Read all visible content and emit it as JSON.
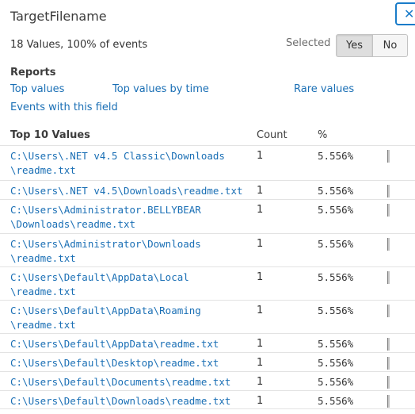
{
  "header": {
    "title": "TargetFilename",
    "close_label": "✕"
  },
  "summary": {
    "text": "18 Values, 100% of events",
    "selected_label": "Selected",
    "yes_label": "Yes",
    "no_label": "No"
  },
  "reports": {
    "heading": "Reports",
    "links": {
      "top_values": "Top values",
      "top_values_by_time": "Top values by time",
      "rare_values": "Rare values",
      "events_with_field": "Events with this field"
    }
  },
  "table": {
    "heading": "Top 10 Values",
    "count_header": "Count",
    "pct_header": "%",
    "rows": [
      {
        "path": "C:\\Users\\.NET v4.5 Classic\\Downloads\n\\readme.txt",
        "count": "1",
        "pct": "5.556%",
        "bar_fraction": 0.05556
      },
      {
        "path": "C:\\Users\\.NET v4.5\\Downloads\\readme.txt",
        "count": "1",
        "pct": "5.556%",
        "bar_fraction": 0.05556
      },
      {
        "path": "C:\\Users\\Administrator.BELLYBEAR\n\\Downloads\\readme.txt",
        "count": "1",
        "pct": "5.556%",
        "bar_fraction": 0.05556
      },
      {
        "path": "C:\\Users\\Administrator\\Downloads\n\\readme.txt",
        "count": "1",
        "pct": "5.556%",
        "bar_fraction": 0.05556
      },
      {
        "path": "C:\\Users\\Default\\AppData\\Local\n\\readme.txt",
        "count": "1",
        "pct": "5.556%",
        "bar_fraction": 0.05556
      },
      {
        "path": "C:\\Users\\Default\\AppData\\Roaming\n\\readme.txt",
        "count": "1",
        "pct": "5.556%",
        "bar_fraction": 0.05556
      },
      {
        "path": "C:\\Users\\Default\\AppData\\readme.txt",
        "count": "1",
        "pct": "5.556%",
        "bar_fraction": 0.05556
      },
      {
        "path": "C:\\Users\\Default\\Desktop\\readme.txt",
        "count": "1",
        "pct": "5.556%",
        "bar_fraction": 0.05556
      },
      {
        "path": "C:\\Users\\Default\\Documents\\readme.txt",
        "count": "1",
        "pct": "5.556%",
        "bar_fraction": 0.05556
      },
      {
        "path": "C:\\Users\\Default\\Downloads\\readme.txt",
        "count": "1",
        "pct": "5.556%",
        "bar_fraction": 0.05556
      }
    ]
  }
}
